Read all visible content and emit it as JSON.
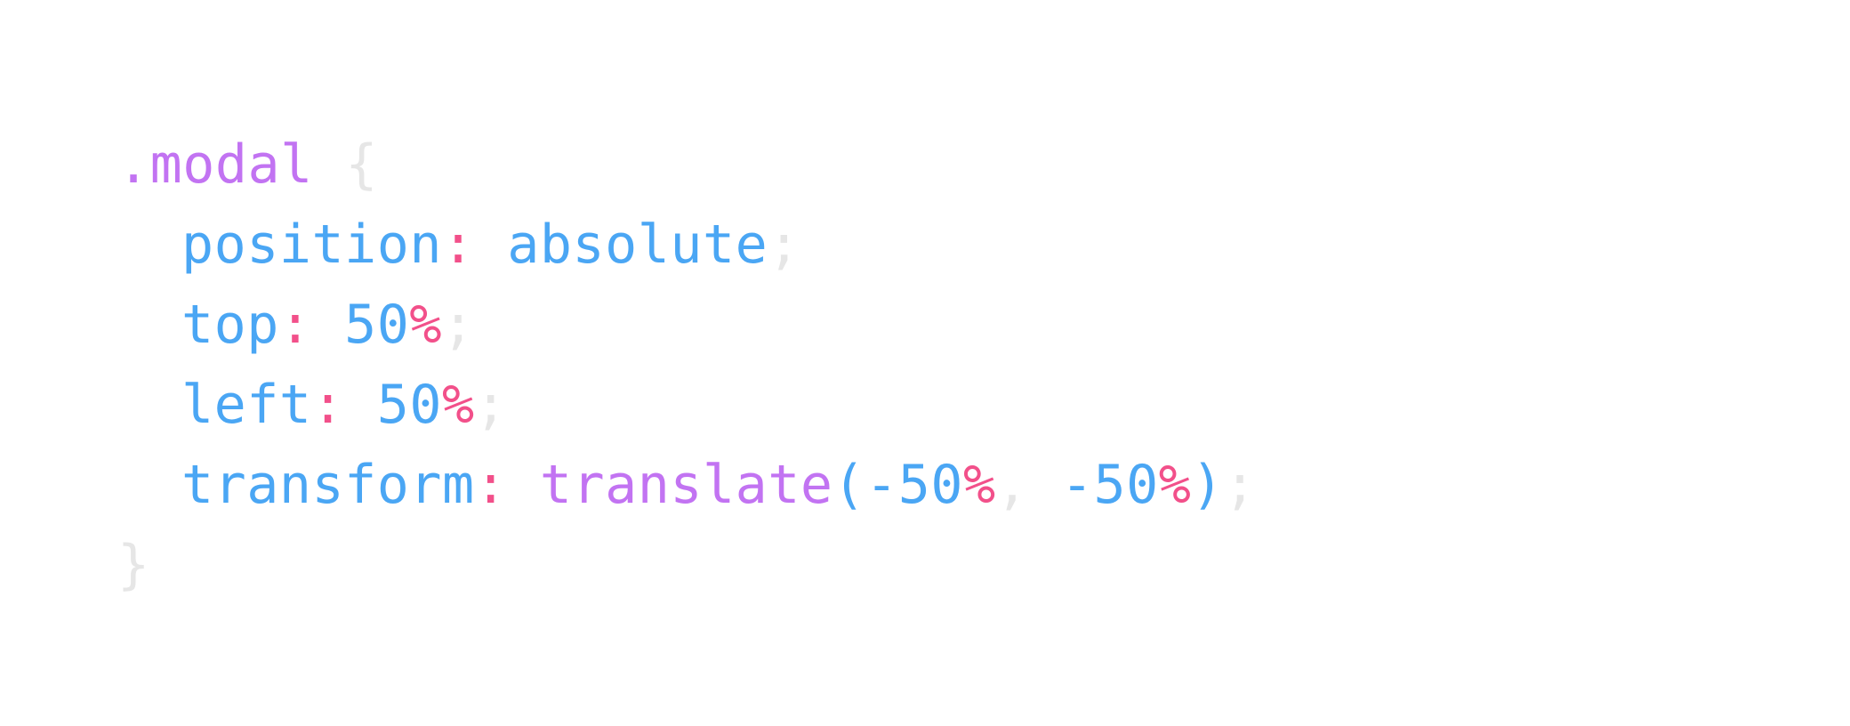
{
  "code": {
    "selector": ".modal",
    "open_brace": "{",
    "close_brace": "}",
    "declarations": [
      {
        "property": "position",
        "colon": ":",
        "value": "absolute",
        "semicolon": ";"
      },
      {
        "property": "top",
        "colon": ":",
        "number": "50",
        "unit": "%",
        "semicolon": ";"
      },
      {
        "property": "left",
        "colon": ":",
        "number": "50",
        "unit": "%",
        "semicolon": ";"
      },
      {
        "property": "transform",
        "colon": ":",
        "function": "translate",
        "open_paren": "(",
        "arg1_number": "-50",
        "arg1_unit": "%",
        "comma": ",",
        "arg2_number": "-50",
        "arg2_unit": "%",
        "close_paren": ")",
        "semicolon": ";"
      }
    ]
  },
  "colors": {
    "selector": "#c273f2",
    "punctuation": "#e6e6e6",
    "property": "#4aa6f4",
    "colon": "#f2508a",
    "unit": "#f2508a",
    "function": "#c273f2"
  }
}
